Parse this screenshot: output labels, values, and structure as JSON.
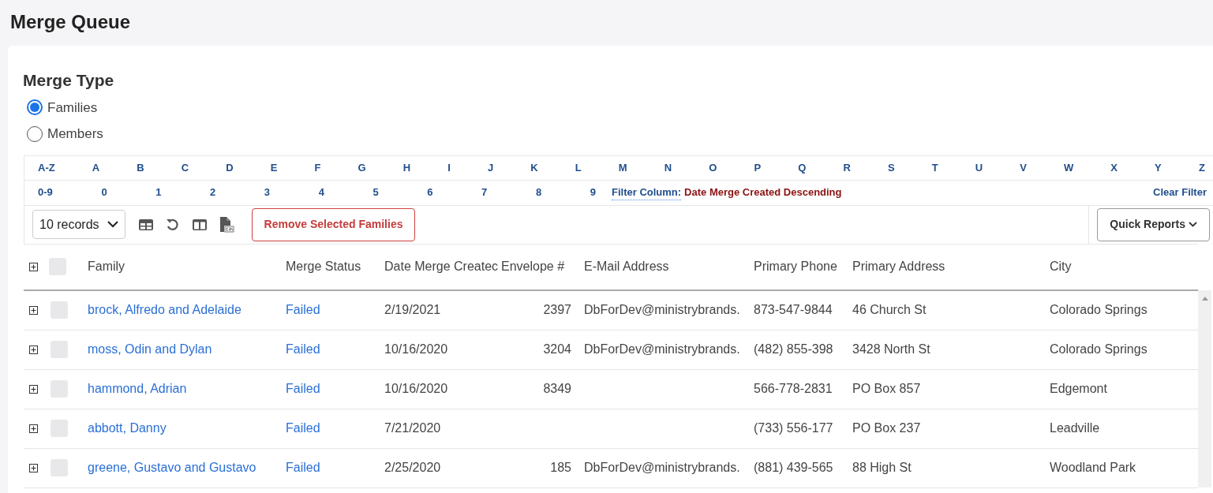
{
  "page_title": "Merge Queue",
  "merge_type": {
    "heading": "Merge Type",
    "options": [
      {
        "label": "Families",
        "selected": true
      },
      {
        "label": "Members",
        "selected": false
      }
    ]
  },
  "letter_filter": [
    "A-Z",
    "A",
    "B",
    "C",
    "D",
    "E",
    "F",
    "G",
    "H",
    "I",
    "J",
    "K",
    "L",
    "M",
    "N",
    "O",
    "P",
    "Q",
    "R",
    "S",
    "T",
    "U",
    "V",
    "W",
    "X",
    "Y",
    "Z"
  ],
  "number_filter": [
    "0-9",
    "0",
    "1",
    "2",
    "3",
    "4",
    "5",
    "6",
    "7",
    "8",
    "9"
  ],
  "filter_column": {
    "label": "Filter Column:",
    "value": "Date Merge Created Descending",
    "clear": "Clear Filter"
  },
  "toolbar": {
    "records": "10 records",
    "remove_button": "Remove Selected Families",
    "quick_reports": "Quick Reports"
  },
  "table": {
    "select_all_checked": false,
    "columns": [
      "Family",
      "Merge Status",
      "Date Merge Createc",
      "Envelope #",
      "E-Mail Address",
      "Primary Phone",
      "Primary Address",
      "City"
    ],
    "rows": [
      {
        "checked": false,
        "family": "brock, Alfredo and Adelaide",
        "status": "Failed",
        "date": "2/19/2021",
        "envelope": "2397",
        "email": "DbForDev@ministrybrands.",
        "phone": "873-547-9844",
        "address": "46 Church St",
        "city": "Colorado Springs"
      },
      {
        "checked": false,
        "family": "moss, Odin and Dylan",
        "status": "Failed",
        "date": "10/16/2020",
        "envelope": "3204",
        "email": "DbForDev@ministrybrands.",
        "phone": "(482) 855-398",
        "address": "3428 North St",
        "city": "Colorado Springs"
      },
      {
        "checked": false,
        "family": "hammond, Adrian",
        "status": "Failed",
        "date": "10/16/2020",
        "envelope": "8349",
        "email": "",
        "phone": "566-778-2831",
        "address": "PO Box 857",
        "city": "Edgemont"
      },
      {
        "checked": false,
        "family": "abbott, Danny",
        "status": "Failed",
        "date": "7/21/2020",
        "envelope": "",
        "email": "",
        "phone": "(733) 556-177",
        "address": "PO Box 237",
        "city": "Leadville"
      },
      {
        "checked": false,
        "family": "greene, Gustavo and Gustavo",
        "status": "Failed",
        "date": "2/25/2020",
        "envelope": "185",
        "email": "DbForDev@ministrybrands.",
        "phone": "(881) 439-565",
        "address": "88 High St",
        "city": "Woodland Park"
      }
    ]
  }
}
